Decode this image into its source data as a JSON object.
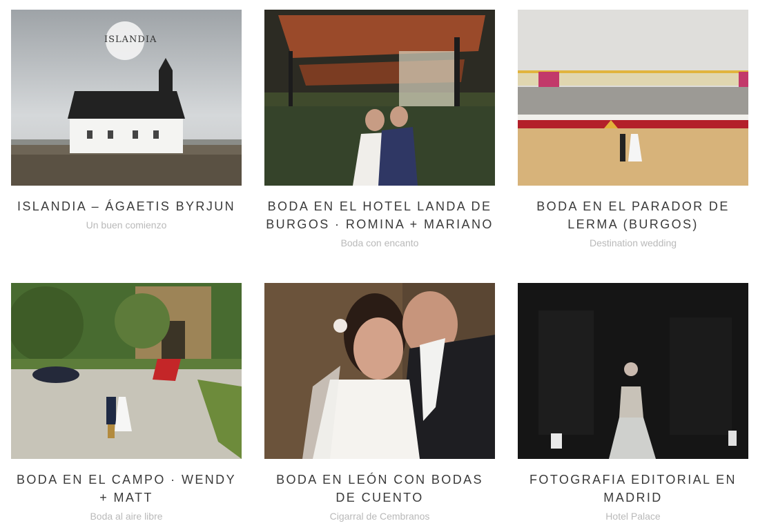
{
  "gallery": {
    "items": [
      {
        "title": "ISLANDIA – ÁGAETIS BYRJUN",
        "subtitle": "Un buen comienzo",
        "badge": "ISLANDIA"
      },
      {
        "title": "BODA EN EL HOTEL LANDA DE BURGOS · ROMINA + MARIANO",
        "subtitle": "Boda con encanto"
      },
      {
        "title": "BODA EN EL PARADOR DE LERMA (BURGOS)",
        "subtitle": "Destination wedding"
      },
      {
        "title": "BODA EN EL CAMPO · WENDY + MATT",
        "subtitle": "Boda al aire libre"
      },
      {
        "title": "BODA EN LEÓN CON BODAS DE CUENTO",
        "subtitle": "Cigarral de Cembranos"
      },
      {
        "title": "FOTOGRAFIA EDITORIAL EN MADRID",
        "subtitle": "Hotel Palace"
      }
    ]
  }
}
